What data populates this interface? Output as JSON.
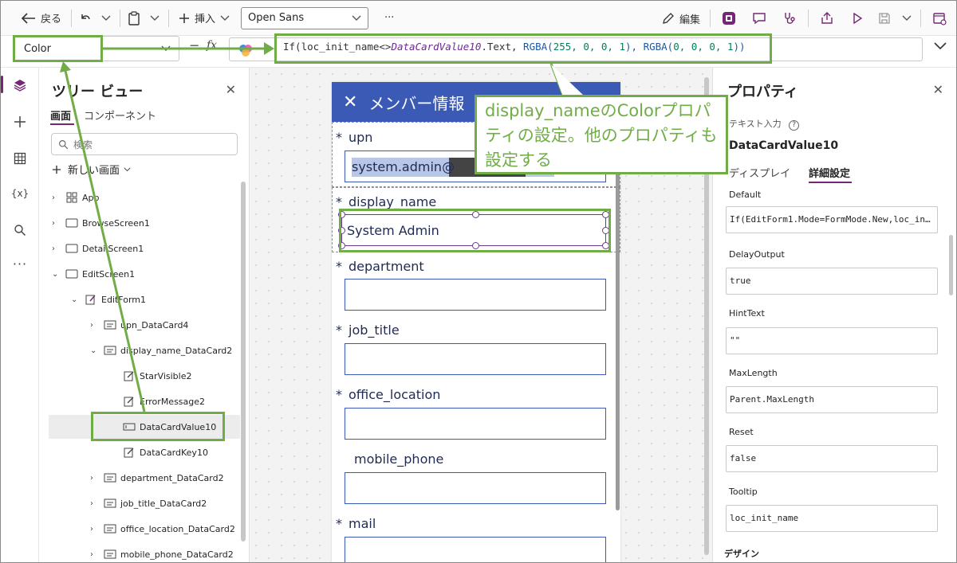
{
  "toolbar": {
    "back_label": "戻る",
    "insert_label": "挿入",
    "font_value": "Open Sans",
    "more_label": "···",
    "edit_label": "編集"
  },
  "formula_bar": {
    "property_value": "Color",
    "eq_label": "=",
    "fx_label": "fx",
    "formula": {
      "p1": "If(loc_init_name<>",
      "p2": "DataCardValue10",
      "p3": ".Text, ",
      "p4": "RGBA(",
      "p5": "255, 0, 0, 1",
      "p6": "), ",
      "p7": "RGBA(",
      "p8": "0, 0, 0, 1",
      "p9": "))"
    }
  },
  "tree_view": {
    "title": "ツリー ビュー",
    "tabs": [
      "画面",
      "コンポーネント"
    ],
    "search_placeholder": "検索",
    "new_screen_label": "新しい画面",
    "nodes": [
      {
        "label": "App"
      },
      {
        "label": "BrowseScreen1"
      },
      {
        "label": "DetailScreen1"
      },
      {
        "label": "EditScreen1"
      },
      {
        "label": "EditForm1"
      },
      {
        "label": "upn_DataCard4"
      },
      {
        "label": "display_name_DataCard2"
      },
      {
        "label": "StarVisible2"
      },
      {
        "label": "ErrorMessage2"
      },
      {
        "label": "DataCardValue10"
      },
      {
        "label": "DataCardKey10"
      },
      {
        "label": "department_DataCard2"
      },
      {
        "label": "job_title_DataCard2"
      },
      {
        "label": "office_location_DataCard2"
      },
      {
        "label": "mobile_phone_DataCard2"
      }
    ]
  },
  "app_screen": {
    "header_title": "メンバー情報",
    "fields": [
      {
        "label": "upn",
        "star": "*",
        "value": "system.admin@"
      },
      {
        "label": "display_name",
        "star": "*",
        "value": "System Admin"
      },
      {
        "label": "department",
        "star": "*",
        "value": ""
      },
      {
        "label": "job_title",
        "star": "*",
        "value": ""
      },
      {
        "label": "office_location",
        "star": "*",
        "value": ""
      },
      {
        "label": "mobile_phone",
        "star": "",
        "value": ""
      },
      {
        "label": "mail",
        "star": "*",
        "value": ""
      }
    ]
  },
  "properties": {
    "title": "プロパティ",
    "control_type": "テキスト入力",
    "control_name": "DataCardValue10",
    "tabs": [
      "ディスプレイ",
      "詳細設定"
    ],
    "items": [
      {
        "label": "Default",
        "value": "If(EditForm1.Mode=FormMode.New,loc_in…"
      },
      {
        "label": "DelayOutput",
        "value": "true"
      },
      {
        "label": "HintText",
        "value": "\"\""
      },
      {
        "label": "MaxLength",
        "value": "Parent.MaxLength"
      },
      {
        "label": "Reset",
        "value": "false"
      },
      {
        "label": "Tooltip",
        "value": "loc_init_name"
      }
    ],
    "section_label": "デザイン"
  },
  "annotation": {
    "callout_text": "display_nameのColorプロパティの設定。他のプロパティも設定する",
    "color": "#70ad47"
  },
  "colors": {
    "accent": "#742774",
    "app_header": "#3a5ab6",
    "annotation": "#70ad47"
  }
}
